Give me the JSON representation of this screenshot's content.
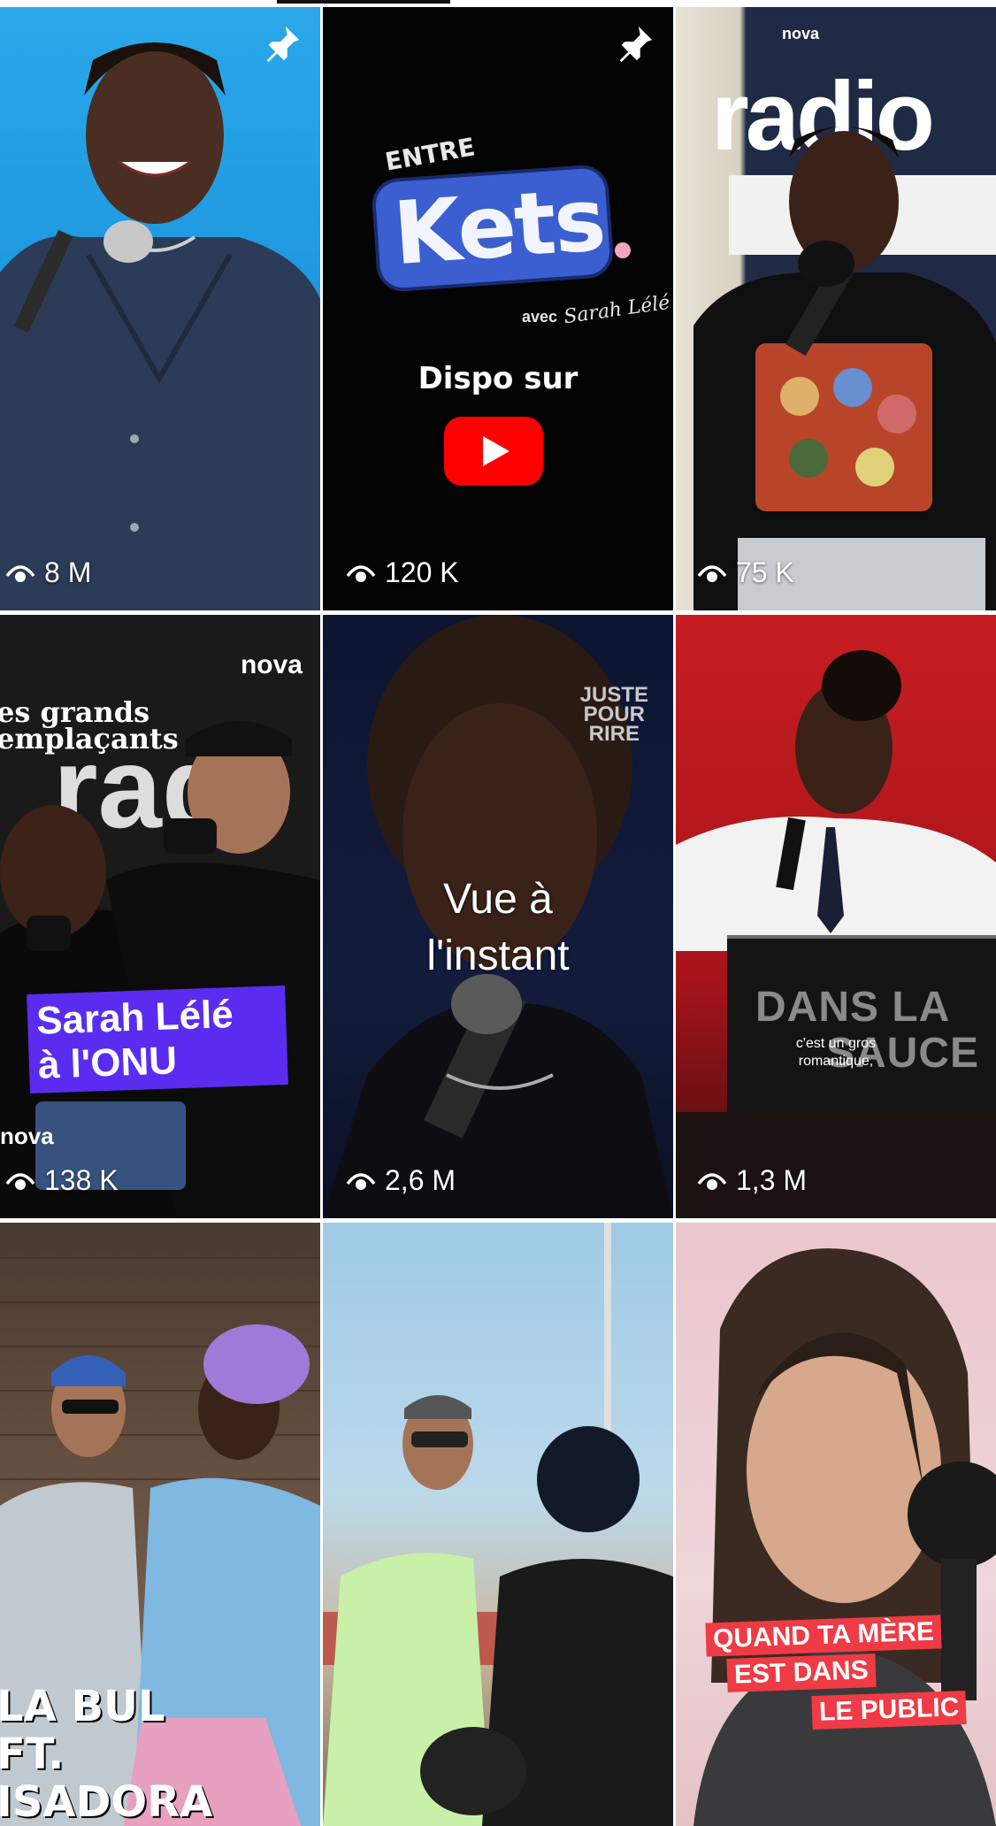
{
  "tiles": [
    {
      "views": "8 M",
      "pinned": true
    },
    {
      "views": "120 K",
      "pinned": true,
      "brand_top": "ENTRE",
      "brand_main": "Kets",
      "brand_by": "avec",
      "brand_sign": "Sarah Lélé",
      "caption": "Dispo sur"
    },
    {
      "views": "75 K",
      "pinned": false,
      "logo_small": "nova",
      "logo_big": "radio"
    },
    {
      "views": "138 K",
      "pinned": false,
      "logo_small": "nova",
      "overlay_title_1": "es grands",
      "overlay_title_2": "emplaçants",
      "banner_line1": "Sarah Lélé",
      "banner_line2": "à l'ONU",
      "corner_logo": "nova"
    },
    {
      "views": "2,6 M",
      "pinned": false,
      "watermark": [
        "JUSTE",
        "POUR",
        "RIRE"
      ],
      "status_line1": "Vue à",
      "status_line2": "l'instant"
    },
    {
      "views": "1,3 M",
      "pinned": false,
      "podium_line1": "DANS LA",
      "podium_line2": "SAUCE",
      "subtitle_1": "c'est un gros",
      "subtitle_2": "romantique,"
    },
    {
      "views": "",
      "pinned": false,
      "overlay_1": "LA BUL",
      "overlay_2": "FT.",
      "overlay_3": "ISADORA"
    },
    {
      "views": "",
      "pinned": false
    },
    {
      "views": "",
      "pinned": false,
      "banner_1": "QUAND TA MÈRE",
      "banner_2": "EST DANS",
      "banner_3": "LE PUBLIC"
    }
  ],
  "colors": {
    "youtube_red": "#ff0000",
    "kets_blue": "#3b5fd0",
    "banner_purple": "#5a2cf0",
    "banner_red": "#ef3b45"
  },
  "icons": {
    "views": "eye-icon",
    "pinned": "pin-icon"
  }
}
